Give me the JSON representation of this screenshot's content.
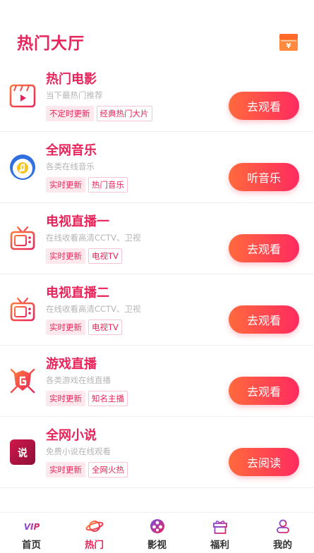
{
  "header": {
    "title": "热门大厅",
    "wallet_symbol": "¥"
  },
  "items": [
    {
      "title": "热门电影",
      "desc": "当下最热门推荐",
      "tags": [
        "不定时更新",
        "经典热门大片"
      ],
      "button": "去观看",
      "icon": "film-icon"
    },
    {
      "title": "全网音乐",
      "desc": "各类在线音乐",
      "tags": [
        "实时更新",
        "热门音乐"
      ],
      "button": "听音乐",
      "icon": "music-disc-icon"
    },
    {
      "title": "电视直播一",
      "desc": "在线收看高清CCTV、卫视",
      "tags": [
        "实时更新",
        "电视TV"
      ],
      "button": "去观看",
      "icon": "tv-icon"
    },
    {
      "title": "电视直播二",
      "desc": "在线收看高清CCTV、卫视",
      "tags": [
        "实时更新",
        "电视TV"
      ],
      "button": "去观看",
      "icon": "tv-icon"
    },
    {
      "title": "游戏直播",
      "desc": "各类游戏在线直播",
      "tags": [
        "实时更新",
        "知名主播"
      ],
      "button": "去观看",
      "icon": "game-shield-icon"
    },
    {
      "title": "全网小说",
      "desc": "免费小说在线观看",
      "tags": [
        "实时更新",
        "全网火热"
      ],
      "button": "去阅读",
      "icon": "novel-icon",
      "icon_text": "说"
    }
  ],
  "tabbar": [
    {
      "label": "首页",
      "icon": "vip-icon",
      "icon_text": "VIP"
    },
    {
      "label": "热门",
      "icon": "planet-icon",
      "active": true
    },
    {
      "label": "影视",
      "icon": "film-reel-icon"
    },
    {
      "label": "福利",
      "icon": "gift-icon"
    },
    {
      "label": "我的",
      "icon": "user-icon"
    }
  ],
  "colors": {
    "accent": "#e8245a",
    "button_start": "#ff6a3d",
    "button_end": "#ff2a5f",
    "tag_bg": "#fde8ee"
  }
}
